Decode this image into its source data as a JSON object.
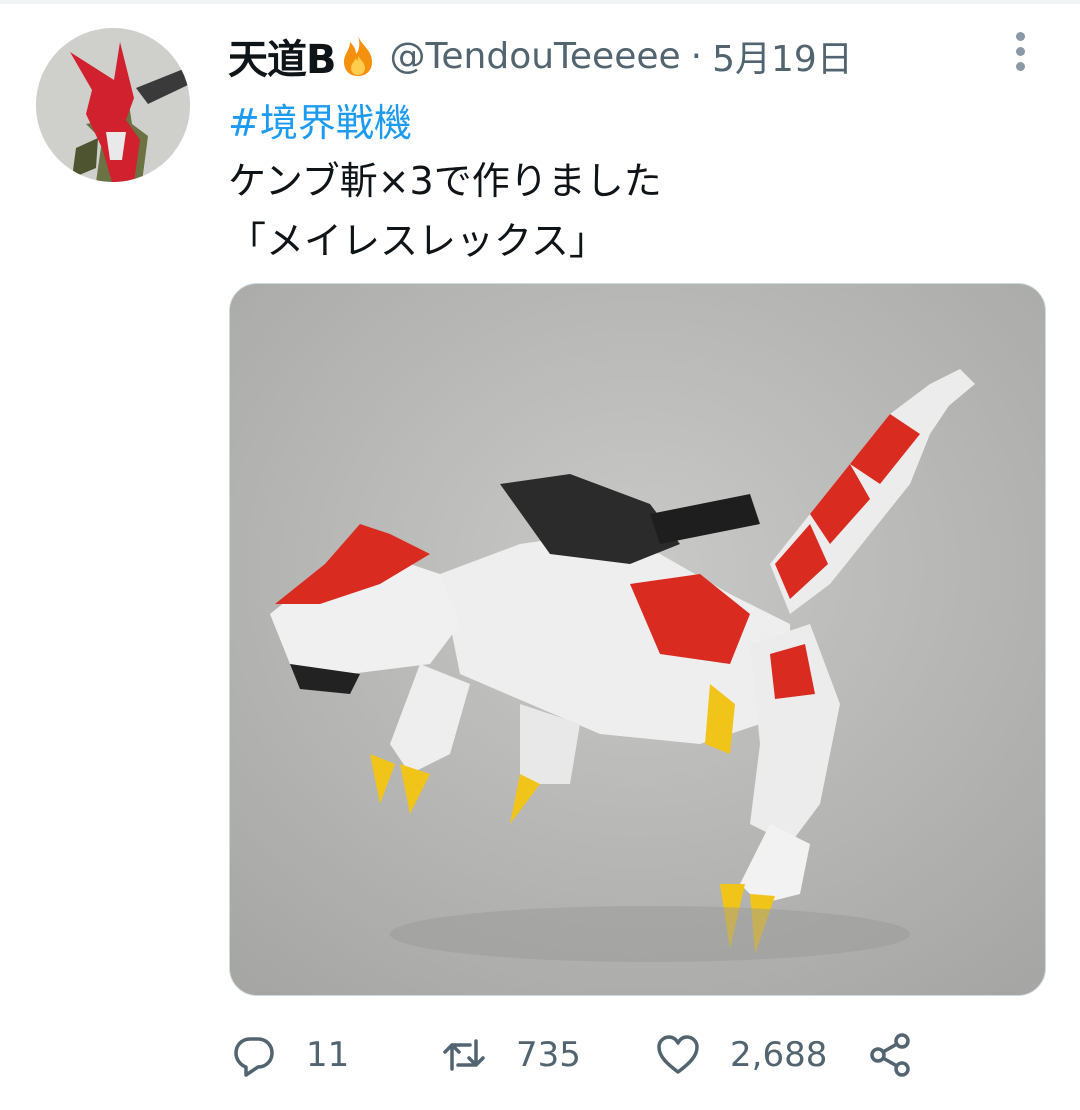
{
  "tweet": {
    "display_name": "天道B",
    "handle": "@TendouTeeeee",
    "separator": "·",
    "date": "5月19日",
    "hashtag": "#境界戦機",
    "lines": [
      "ケンブ斬×3で作りました",
      "「メイレスレックス」"
    ]
  },
  "icons": {
    "verified_emoji": "fire-icon",
    "more": "more-vertical-icon",
    "reply": "reply-icon",
    "retweet": "retweet-icon",
    "like": "heart-icon",
    "share": "share-icon"
  },
  "actions": {
    "reply_count": "11",
    "retweet_count": "735",
    "like_count": "2,688"
  },
  "colors": {
    "link": "#1d9bf0",
    "secondary_text": "#536471",
    "primary_text": "#0f1419"
  }
}
